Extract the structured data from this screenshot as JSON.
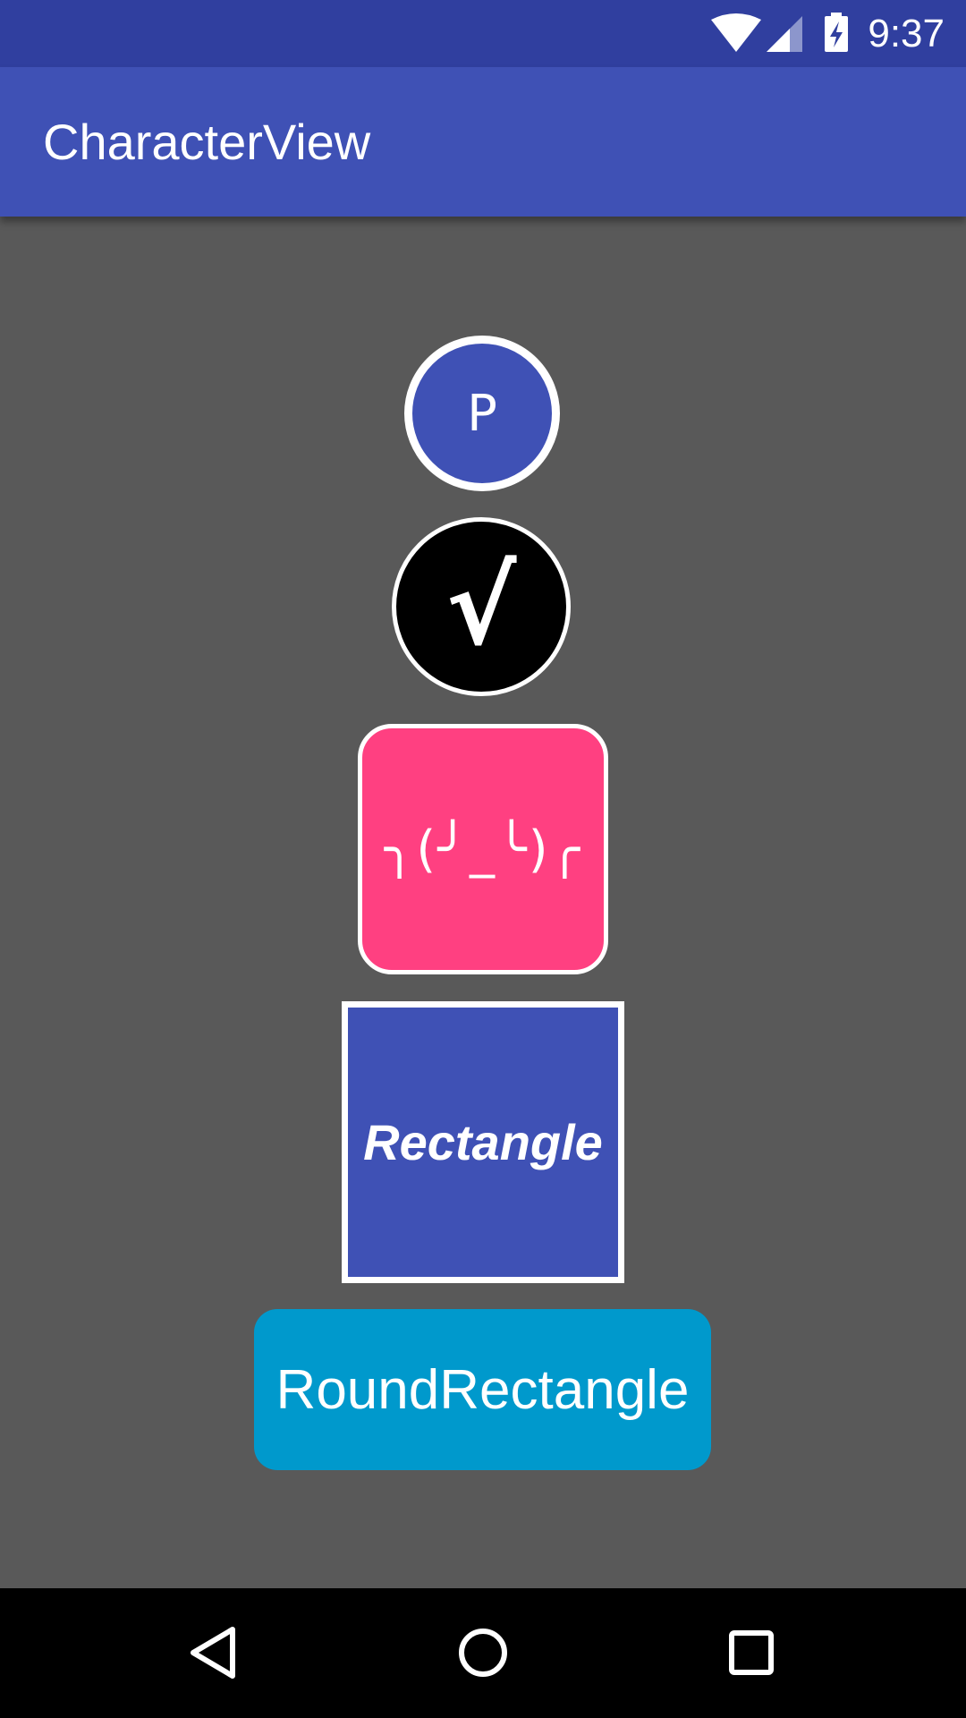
{
  "status_bar": {
    "time": "9:37",
    "icons": [
      "wifi-icon",
      "cell-signal-icon",
      "battery-charging-icon"
    ]
  },
  "app_bar": {
    "title": "CharacterView"
  },
  "views": [
    {
      "text": "P",
      "shape": "circle",
      "background": "#3F51B5",
      "border": "#FFFFFF"
    },
    {
      "text": "√",
      "shape": "circle",
      "background": "#000000",
      "border": "#FFFFFF"
    },
    {
      "text": "╮(╯_╰)╭",
      "shape": "round-square",
      "background": "#FF4081",
      "border": "#FFFFFF"
    },
    {
      "text": "Rectangle",
      "shape": "rectangle",
      "background": "#3F51B5",
      "border": "#FFFFFF"
    },
    {
      "text": "RoundRectangle",
      "shape": "round-rectangle",
      "background": "#0099CC",
      "border": "none"
    }
  ],
  "colors": {
    "status_bar": "#303F9F",
    "app_bar": "#3F51B5",
    "content_background": "#595959",
    "nav_bar": "#000000"
  },
  "nav_bar": {
    "buttons": [
      "back-icon",
      "home-icon",
      "recents-icon"
    ]
  }
}
